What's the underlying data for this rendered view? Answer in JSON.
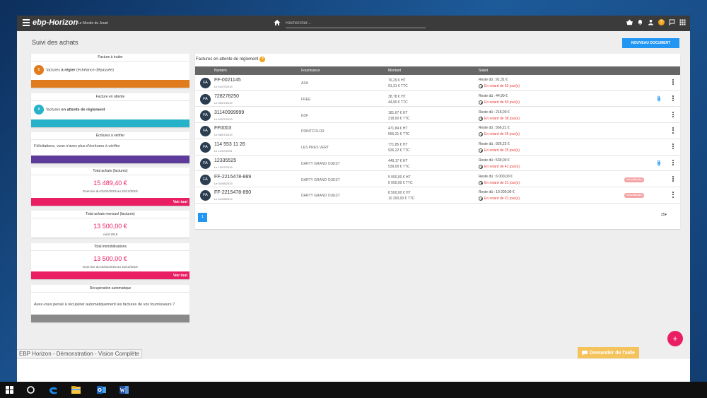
{
  "header": {
    "brand": "ebp-Horizon",
    "subtitle": "Le Monde du Jouet",
    "search_placeholder": "Rechercher...",
    "icons": [
      "home-icon",
      "basket-icon",
      "bell-icon",
      "user-icon",
      "help-icon",
      "chat-icon",
      "apps-grid-icon"
    ],
    "help_label": "?"
  },
  "page": {
    "title": "Suivi des achats",
    "new_document": "NOUVEAU DOCUMENT"
  },
  "cards": [
    {
      "title": "Facture à traiter",
      "count": "6",
      "text_pre": "factures",
      "text_bold": "à régler",
      "text_post": "(échéance dépassée)",
      "color": "#e07c1d"
    },
    {
      "title": "Facture en attente",
      "count": "8",
      "text_pre": "factures",
      "text_bold": "en attente de règlement",
      "text_post": "",
      "color": "#26b3c9"
    },
    {
      "title": "Écritures à vérifier",
      "text": "Félicitations, vous n'avez plus d'écritures à vérifier",
      "color": "#5c3b9a"
    },
    {
      "title": "Total achats (factures)",
      "amount": "15 489,40 €",
      "period": "Exercice du 01/01/2019 au 31/12/2019",
      "link": "Voir tout",
      "color": "#e91e63"
    },
    {
      "title": "Total achats mensuel (factures)",
      "amount": "13 500,00 €",
      "period": "Août 2019"
    },
    {
      "title": "Total immobilisations",
      "amount": "13 500,00 €",
      "period": "Exercice du 01/01/2019 au 31/12/2019",
      "link": "Voir tout",
      "color": "#e91e63"
    },
    {
      "title": "Récupération automatique",
      "text": "Avez-vous pensé à récupérer automatiquement les factures de vos fournisseurs ?",
      "color": "#8a8a8a"
    }
  ],
  "table": {
    "title": "Factures en attente de règlement",
    "help_label": "?",
    "columns": [
      "Numéro",
      "Fournisseur",
      "Montant",
      "Statut"
    ],
    "rows": [
      {
        "badge": "FA",
        "number": "FF-0021145",
        "date": "Le 01/07/2019",
        "supplier": "AXA",
        "ht": "76,29 € HT",
        "ttc": "91,31 € TTC",
        "reste": "Reste dû : 91,31 €",
        "late": "En retard de 52 jour(s)",
        "tag": "",
        "clip": false
      },
      {
        "badge": "FA",
        "number": "728278250",
        "date": "Le 03/07/2019",
        "supplier": "FREE",
        "ht": "38,78 € HT",
        "ttc": "44,90 € TTC",
        "reste": "Reste dû : 44,90 €",
        "late": "En retard de 50 jour(s)",
        "tag": "",
        "clip": true
      },
      {
        "badge": "FA",
        "number": "31140999999",
        "date": "Le 04/07/2019",
        "supplier": "EDF",
        "ht": "181,67 € HT",
        "ttc": "218,00 € TTC",
        "reste": "Reste dû : 218,00 €",
        "late": "En retard de 38 jour(s)",
        "tag": "",
        "clip": false
      },
      {
        "badge": "FA",
        "number": "FF0003",
        "date": "Le 08/07/2019",
        "supplier": "PRINTCOLOR",
        "ht": "471,84 € HT",
        "ttc": "566,21 € TTC",
        "reste": "Reste dû : 566,21 €",
        "late": "En retard de 25 jour(s)",
        "tag": "",
        "clip": false
      },
      {
        "badge": "FA",
        "number": "114 553 11 26",
        "date": "Le 11/07/2019",
        "supplier": "LES PRES VERT",
        "ht": "771,85 € HT",
        "ttc": "926,22 € TTC",
        "reste": "Reste dû : 926,22 €",
        "late": "En retard de 25 jour(s)",
        "tag": "",
        "clip": false
      },
      {
        "badge": "FA",
        "number": "12335525",
        "date": "Le 12/07/2019",
        "supplier": "DARTY GRAND OUEST",
        "ht": "449,17 € HT",
        "ttc": "539,00 € TTC",
        "reste": "Reste dû : 539,00 €",
        "late": "En retard de 41 jour(s)",
        "tag": "",
        "clip": true
      },
      {
        "badge": "FA",
        "number": "FF-2215478-889",
        "date": "Le 01/08/2019",
        "supplier": "DARTY GRAND OUEST",
        "ht": "5 000,00 € HT",
        "ttc": "6 000,00 € TTC",
        "reste": "Reste dû : 6 000,00 €",
        "late": "En retard de 21 jour(s)",
        "tag": "Immobilisation",
        "clip": false
      },
      {
        "badge": "FA",
        "number": "FF-2215478-890",
        "date": "Le 01/08/2019",
        "supplier": "DARTY GRAND OUEST",
        "ht": "8 500,00 € HT",
        "ttc": "10 200,00 € TTC",
        "reste": "Reste dû : 10 200,00 €",
        "late": "En retard de 21 jour(s)",
        "tag": "Immobilisation",
        "clip": false
      }
    ],
    "page": "1",
    "per_page": "25▾"
  },
  "fab_label": "+",
  "status_tab": "EBP Horizon - Démonstration - Vision Complète",
  "help_button": "Demander de l'aide",
  "taskbar": [
    "windows-start-icon",
    "cortana-icon",
    "edge-icon",
    "file-explorer-icon",
    "outlook-icon",
    "word-icon"
  ]
}
